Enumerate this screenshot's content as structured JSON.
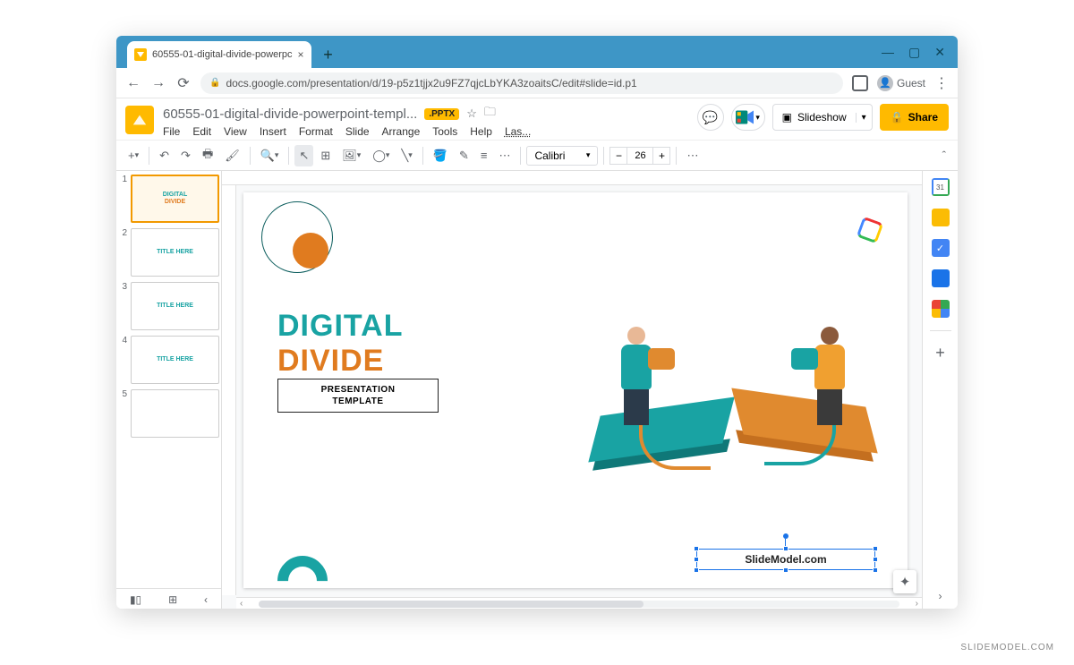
{
  "window": {
    "tab_title": "60555-01-digital-divide-powerpc",
    "url": "docs.google.com/presentation/d/19-p5z1tjjx2u9FZ7qjcLbYKA3zoaitsC/edit#slide=id.p1",
    "guest": "Guest"
  },
  "app": {
    "title": "60555-01-digital-divide-powerpoint-templ...",
    "badge": ".PPTX",
    "last": "Las...",
    "menus": [
      "File",
      "Edit",
      "View",
      "Insert",
      "Format",
      "Slide",
      "Arrange",
      "Tools",
      "Help"
    ],
    "slideshow": "Slideshow",
    "share": "Share"
  },
  "toolbar": {
    "font": "Calibri",
    "size": "26"
  },
  "filmstrip": {
    "slides": [
      {
        "num": "1",
        "sel": true,
        "l1": "DIGITAL",
        "l2": "DIVIDE"
      },
      {
        "num": "2",
        "sel": false,
        "l1": "TITLE HERE",
        "l2": ""
      },
      {
        "num": "3",
        "sel": false,
        "l1": "TITLE HERE",
        "l2": ""
      },
      {
        "num": "4",
        "sel": false,
        "l1": "TITLE HERE",
        "l2": ""
      },
      {
        "num": "5",
        "sel": false,
        "l1": "",
        "l2": ""
      }
    ]
  },
  "slide": {
    "title1": "DIGITAL",
    "title2": "DIVIDE",
    "sub1": "PRESENTATION",
    "sub2": "TEMPLATE",
    "selected_text": "SlideModel.com"
  },
  "sidepanel": {
    "cal": "31"
  },
  "watermark": "SLIDEMODEL.COM"
}
